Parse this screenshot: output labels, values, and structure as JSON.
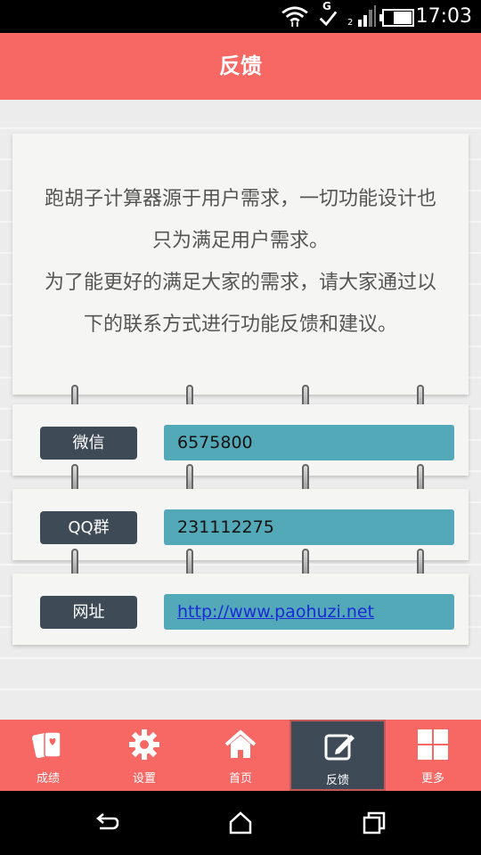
{
  "status_bar": {
    "time": "17:03",
    "network_label": "G"
  },
  "header": {
    "title": "反馈"
  },
  "intro": {
    "lines": [
      "跑胡子计算器源于用户需求，一切功能设计也",
      "只为满足用户需求。",
      "为了能更好的满足大家的需求，请大家通过以",
      "下的联系方式进行功能反馈和建议。"
    ]
  },
  "contacts": [
    {
      "label": "微信",
      "value": "6575800"
    },
    {
      "label": "QQ群",
      "value": "231112275"
    },
    {
      "label": "网址",
      "value": "http://www.paohuzi.net"
    }
  ],
  "nav": {
    "items": [
      {
        "label": "成绩",
        "icon": "cards-icon"
      },
      {
        "label": "设置",
        "icon": "gear-icon"
      },
      {
        "label": "首页",
        "icon": "home-icon"
      },
      {
        "label": "反馈",
        "icon": "edit-icon",
        "active": true
      },
      {
        "label": "更多",
        "icon": "grid-icon"
      }
    ]
  },
  "colors": {
    "accent": "#f76764",
    "dark": "#3e4a56",
    "teal": "#54a9b9"
  }
}
